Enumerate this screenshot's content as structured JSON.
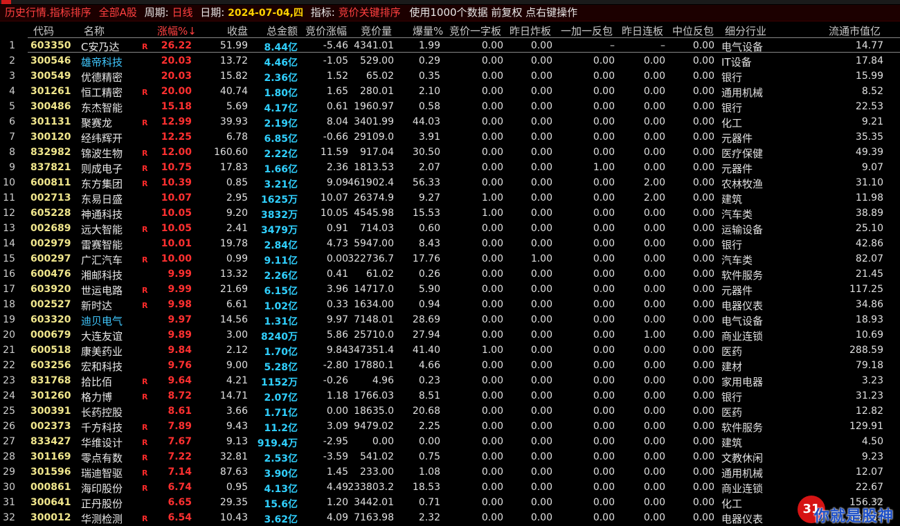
{
  "window": {
    "title_tag": "历史行情.指标排序",
    "market": "全部A股",
    "period_label": "周期:",
    "period_value": "日线",
    "date_label": "日期:",
    "date_value": "2024-07-04,四",
    "indicator_label": "指标:",
    "indicator_value": "竞价关键排序",
    "usage_note": "使用1000个数据 前复权 点右键操作"
  },
  "columns": [
    "代码",
    "名称",
    "涨幅%↓",
    "收盘",
    "总金额",
    "竞价涨幅",
    "竞价量",
    "爆量%",
    "竞价一字板",
    "昨日炸板",
    "一加一反包",
    "昨日连板",
    "中位反包",
    "细分行业",
    "流通市值亿"
  ],
  "rows": [
    {
      "n": "1",
      "code": "603350",
      "name": "C安乃达",
      "nc": "w",
      "r": true,
      "chg": "26.22",
      "close": "51.99",
      "amt": "8.44",
      "u": "亿",
      "jjzf": "-5.46",
      "jjl": "4341.01",
      "bl": "1.99",
      "yzb": "0.00",
      "zrzb": "0.00",
      "yjy": "–",
      "zrlb": "–",
      "zwfb": "0.00",
      "ind": "电气设备",
      "ltsz": "14.77"
    },
    {
      "n": "2",
      "code": "300546",
      "name": "雄帝科技",
      "nc": "c1",
      "r": false,
      "chg": "20.03",
      "close": "13.72",
      "amt": "4.46",
      "u": "亿",
      "jjzf": "-1.05",
      "jjl": "529.00",
      "bl": "0.29",
      "yzb": "0.00",
      "zrzb": "0.00",
      "yjy": "0.00",
      "zrlb": "0.00",
      "zwfb": "0.00",
      "ind": "IT设备",
      "ltsz": "17.84"
    },
    {
      "n": "3",
      "code": "300549",
      "name": "优德精密",
      "nc": "w",
      "r": false,
      "chg": "20.03",
      "close": "15.82",
      "amt": "2.36",
      "u": "亿",
      "jjzf": "1.52",
      "jjl": "65.02",
      "bl": "0.35",
      "yzb": "0.00",
      "zrzb": "0.00",
      "yjy": "0.00",
      "zrlb": "0.00",
      "zwfb": "0.00",
      "ind": "银行",
      "ltsz": "15.99"
    },
    {
      "n": "4",
      "code": "301261",
      "name": "恒工精密",
      "nc": "w",
      "r": true,
      "chg": "20.00",
      "close": "40.74",
      "amt": "1.80",
      "u": "亿",
      "jjzf": "1.65",
      "jjl": "280.01",
      "bl": "2.10",
      "yzb": "0.00",
      "zrzb": "0.00",
      "yjy": "0.00",
      "zrlb": "0.00",
      "zwfb": "0.00",
      "ind": "通用机械",
      "ltsz": "8.52"
    },
    {
      "n": "5",
      "code": "300486",
      "name": "东杰智能",
      "nc": "w",
      "r": false,
      "chg": "15.18",
      "close": "5.69",
      "amt": "4.17",
      "u": "亿",
      "jjzf": "0.61",
      "jjl": "1960.97",
      "bl": "0.58",
      "yzb": "0.00",
      "zrzb": "0.00",
      "yjy": "0.00",
      "zrlb": "0.00",
      "zwfb": "0.00",
      "ind": "银行",
      "ltsz": "22.53"
    },
    {
      "n": "6",
      "code": "301131",
      "name": "聚赛龙",
      "nc": "w",
      "r": true,
      "chg": "12.99",
      "close": "39.93",
      "amt": "2.19",
      "u": "亿",
      "jjzf": "8.04",
      "jjl": "3401.99",
      "bl": "44.03",
      "yzb": "0.00",
      "zrzb": "0.00",
      "yjy": "0.00",
      "zrlb": "0.00",
      "zwfb": "0.00",
      "ind": "化工",
      "ltsz": "9.21"
    },
    {
      "n": "7",
      "code": "300120",
      "name": "经纬辉开",
      "nc": "w",
      "r": false,
      "chg": "12.25",
      "close": "6.78",
      "amt": "6.85",
      "u": "亿",
      "jjzf": "-0.66",
      "jjl": "29109.0",
      "bl": "3.91",
      "yzb": "0.00",
      "zrzb": "0.00",
      "yjy": "0.00",
      "zrlb": "0.00",
      "zwfb": "0.00",
      "ind": "元器件",
      "ltsz": "35.35"
    },
    {
      "n": "8",
      "code": "832982",
      "name": "锦波生物",
      "nc": "w",
      "r": true,
      "chg": "12.00",
      "close": "160.60",
      "amt": "2.22",
      "u": "亿",
      "jjzf": "11.59",
      "jjl": "917.04",
      "bl": "30.50",
      "yzb": "0.00",
      "zrzb": "0.00",
      "yjy": "0.00",
      "zrlb": "0.00",
      "zwfb": "0.00",
      "ind": "医疗保健",
      "ltsz": "49.39"
    },
    {
      "n": "9",
      "code": "837821",
      "name": "则成电子",
      "nc": "w",
      "r": true,
      "chg": "10.75",
      "close": "17.83",
      "amt": "1.66",
      "u": "亿",
      "jjzf": "2.36",
      "jjl": "1813.53",
      "bl": "2.07",
      "yzb": "0.00",
      "zrzb": "0.00",
      "yjy": "1.00",
      "zrlb": "0.00",
      "zwfb": "0.00",
      "ind": "元器件",
      "ltsz": "9.07"
    },
    {
      "n": "10",
      "code": "600811",
      "name": "东方集团",
      "nc": "w",
      "r": true,
      "chg": "10.39",
      "close": "0.85",
      "amt": "3.21",
      "u": "亿",
      "jjzf": "9.09",
      "jjl": "461902.4",
      "bl": "56.33",
      "yzb": "0.00",
      "zrzb": "0.00",
      "yjy": "0.00",
      "zrlb": "2.00",
      "zwfb": "0.00",
      "ind": "农林牧渔",
      "ltsz": "31.10"
    },
    {
      "n": "11",
      "code": "002713",
      "name": "东易日盛",
      "nc": "w",
      "r": false,
      "chg": "10.07",
      "close": "2.95",
      "amt": "1625",
      "u": "万",
      "jjzf": "10.07",
      "jjl": "26374.9",
      "bl": "9.27",
      "yzb": "1.00",
      "zrzb": "0.00",
      "yjy": "0.00",
      "zrlb": "2.00",
      "zwfb": "0.00",
      "ind": "建筑",
      "ltsz": "11.98"
    },
    {
      "n": "12",
      "code": "605228",
      "name": "神通科技",
      "nc": "w",
      "r": false,
      "chg": "10.05",
      "close": "9.20",
      "amt": "3832",
      "u": "万",
      "jjzf": "10.05",
      "jjl": "4545.98",
      "bl": "15.53",
      "yzb": "1.00",
      "zrzb": "0.00",
      "yjy": "0.00",
      "zrlb": "0.00",
      "zwfb": "0.00",
      "ind": "汽车类",
      "ltsz": "38.89"
    },
    {
      "n": "13",
      "code": "002689",
      "name": "远大智能",
      "nc": "w",
      "r": true,
      "chg": "10.05",
      "close": "2.41",
      "amt": "3479",
      "u": "万",
      "jjzf": "0.91",
      "jjl": "714.03",
      "bl": "0.60",
      "yzb": "0.00",
      "zrzb": "0.00",
      "yjy": "0.00",
      "zrlb": "0.00",
      "zwfb": "0.00",
      "ind": "运输设备",
      "ltsz": "25.10"
    },
    {
      "n": "14",
      "code": "002979",
      "name": "雷赛智能",
      "nc": "w",
      "r": false,
      "chg": "10.01",
      "close": "19.78",
      "amt": "2.84",
      "u": "亿",
      "jjzf": "4.73",
      "jjl": "5947.00",
      "bl": "8.43",
      "yzb": "0.00",
      "zrzb": "0.00",
      "yjy": "0.00",
      "zrlb": "0.00",
      "zwfb": "0.00",
      "ind": "银行",
      "ltsz": "42.86"
    },
    {
      "n": "15",
      "code": "600297",
      "name": "广汇汽车",
      "nc": "w",
      "r": true,
      "chg": "10.00",
      "close": "0.99",
      "amt": "9.11",
      "u": "亿",
      "jjzf": "0.00",
      "jjl": "322736.7",
      "bl": "17.76",
      "yzb": "0.00",
      "zrzb": "1.00",
      "yjy": "0.00",
      "zrlb": "0.00",
      "zwfb": "0.00",
      "ind": "汽车类",
      "ltsz": "82.07"
    },
    {
      "n": "16",
      "code": "600476",
      "name": "湘邮科技",
      "nc": "w",
      "r": false,
      "chg": "9.99",
      "close": "13.32",
      "amt": "2.26",
      "u": "亿",
      "jjzf": "0.41",
      "jjl": "61.02",
      "bl": "0.26",
      "yzb": "0.00",
      "zrzb": "0.00",
      "yjy": "0.00",
      "zrlb": "0.00",
      "zwfb": "0.00",
      "ind": "软件服务",
      "ltsz": "21.45"
    },
    {
      "n": "17",
      "code": "603920",
      "name": "世运电路",
      "nc": "w",
      "r": true,
      "chg": "9.99",
      "close": "21.69",
      "amt": "6.15",
      "u": "亿",
      "jjzf": "3.96",
      "jjl": "14717.0",
      "bl": "5.90",
      "yzb": "0.00",
      "zrzb": "0.00",
      "yjy": "0.00",
      "zrlb": "0.00",
      "zwfb": "0.00",
      "ind": "元器件",
      "ltsz": "117.25"
    },
    {
      "n": "18",
      "code": "002527",
      "name": "新时达",
      "nc": "w",
      "r": true,
      "chg": "9.98",
      "close": "6.61",
      "amt": "1.02",
      "u": "亿",
      "jjzf": "0.33",
      "jjl": "1634.00",
      "bl": "0.94",
      "yzb": "0.00",
      "zrzb": "0.00",
      "yjy": "0.00",
      "zrlb": "0.00",
      "zwfb": "0.00",
      "ind": "电器仪表",
      "ltsz": "34.86"
    },
    {
      "n": "19",
      "code": "603320",
      "name": "迪贝电气",
      "nc": "c1",
      "r": false,
      "chg": "9.97",
      "close": "14.56",
      "amt": "1.31",
      "u": "亿",
      "jjzf": "9.97",
      "jjl": "7148.01",
      "bl": "28.69",
      "yzb": "0.00",
      "zrzb": "0.00",
      "yjy": "0.00",
      "zrlb": "0.00",
      "zwfb": "0.00",
      "ind": "电气设备",
      "ltsz": "18.93"
    },
    {
      "n": "20",
      "code": "000679",
      "name": "大连友谊",
      "nc": "w",
      "r": false,
      "chg": "9.89",
      "close": "3.00",
      "amt": "8240",
      "u": "万",
      "jjzf": "5.86",
      "jjl": "25710.0",
      "bl": "27.94",
      "yzb": "0.00",
      "zrzb": "0.00",
      "yjy": "0.00",
      "zrlb": "1.00",
      "zwfb": "0.00",
      "ind": "商业连锁",
      "ltsz": "10.69"
    },
    {
      "n": "21",
      "code": "600518",
      "name": "康美药业",
      "nc": "w",
      "r": false,
      "chg": "9.84",
      "close": "2.12",
      "amt": "1.70",
      "u": "亿",
      "jjzf": "9.84",
      "jjl": "347351.4",
      "bl": "41.40",
      "yzb": "1.00",
      "zrzb": "0.00",
      "yjy": "0.00",
      "zrlb": "0.00",
      "zwfb": "0.00",
      "ind": "医药",
      "ltsz": "288.59"
    },
    {
      "n": "22",
      "code": "603256",
      "name": "宏和科技",
      "nc": "w",
      "r": false,
      "chg": "9.76",
      "close": "9.00",
      "amt": "5.28",
      "u": "亿",
      "jjzf": "-2.80",
      "jjl": "17880.1",
      "bl": "4.66",
      "yzb": "0.00",
      "zrzb": "0.00",
      "yjy": "0.00",
      "zrlb": "0.00",
      "zwfb": "0.00",
      "ind": "建材",
      "ltsz": "79.18"
    },
    {
      "n": "23",
      "code": "831768",
      "name": "拾比佰",
      "nc": "w",
      "r": true,
      "chg": "9.64",
      "close": "4.21",
      "amt": "1152",
      "u": "万",
      "jjzf": "-0.26",
      "jjl": "4.96",
      "bl": "0.23",
      "yzb": "0.00",
      "zrzb": "0.00",
      "yjy": "0.00",
      "zrlb": "0.00",
      "zwfb": "0.00",
      "ind": "家用电器",
      "ltsz": "3.23"
    },
    {
      "n": "24",
      "code": "301260",
      "name": "格力博",
      "nc": "w",
      "r": true,
      "chg": "8.72",
      "close": "14.71",
      "amt": "2.07",
      "u": "亿",
      "jjzf": "1.18",
      "jjl": "1766.03",
      "bl": "8.51",
      "yzb": "0.00",
      "zrzb": "0.00",
      "yjy": "0.00",
      "zrlb": "0.00",
      "zwfb": "0.00",
      "ind": "银行",
      "ltsz": "31.23"
    },
    {
      "n": "25",
      "code": "300391",
      "name": "长药控股",
      "nc": "w",
      "r": false,
      "chg": "8.61",
      "close": "3.66",
      "amt": "1.71",
      "u": "亿",
      "jjzf": "0.00",
      "jjl": "18635.0",
      "bl": "20.68",
      "yzb": "0.00",
      "zrzb": "0.00",
      "yjy": "0.00",
      "zrlb": "0.00",
      "zwfb": "0.00",
      "ind": "医药",
      "ltsz": "12.82"
    },
    {
      "n": "26",
      "code": "002373",
      "name": "千方科技",
      "nc": "w",
      "r": true,
      "chg": "7.89",
      "close": "9.43",
      "amt": "11.2",
      "u": "亿",
      "jjzf": "3.09",
      "jjl": "9479.02",
      "bl": "2.25",
      "yzb": "0.00",
      "zrzb": "0.00",
      "yjy": "0.00",
      "zrlb": "0.00",
      "zwfb": "0.00",
      "ind": "软件服务",
      "ltsz": "129.91"
    },
    {
      "n": "27",
      "code": "833427",
      "name": "华维设计",
      "nc": "w",
      "r": true,
      "chg": "7.67",
      "close": "9.13",
      "amt": "919.4",
      "u": "万",
      "jjzf": "-2.95",
      "jjl": "0.00",
      "bl": "0.00",
      "yzb": "0.00",
      "zrzb": "0.00",
      "yjy": "0.00",
      "zrlb": "0.00",
      "zwfb": "0.00",
      "ind": "建筑",
      "ltsz": "4.50"
    },
    {
      "n": "28",
      "code": "301169",
      "name": "零点有数",
      "nc": "w",
      "r": true,
      "chg": "7.22",
      "close": "32.81",
      "amt": "2.53",
      "u": "亿",
      "jjzf": "-3.59",
      "jjl": "541.02",
      "bl": "0.75",
      "yzb": "0.00",
      "zrzb": "0.00",
      "yjy": "0.00",
      "zrlb": "0.00",
      "zwfb": "0.00",
      "ind": "文教休闲",
      "ltsz": "9.23"
    },
    {
      "n": "29",
      "code": "301596",
      "name": "瑞迪智驱",
      "nc": "w",
      "r": true,
      "chg": "7.14",
      "close": "87.63",
      "amt": "3.90",
      "u": "亿",
      "jjzf": "1.45",
      "jjl": "233.00",
      "bl": "1.08",
      "yzb": "0.00",
      "zrzb": "0.00",
      "yjy": "0.00",
      "zrlb": "0.00",
      "zwfb": "0.00",
      "ind": "通用机械",
      "ltsz": "12.07"
    },
    {
      "n": "30",
      "code": "000861",
      "name": "海印股份",
      "nc": "w",
      "r": true,
      "chg": "6.74",
      "close": "0.95",
      "amt": "4.13",
      "u": "亿",
      "jjzf": "4.49",
      "jjl": "233803.2",
      "bl": "18.53",
      "yzb": "0.00",
      "zrzb": "0.00",
      "yjy": "0.00",
      "zrlb": "0.00",
      "zwfb": "0.00",
      "ind": "商业连锁",
      "ltsz": "22.67"
    },
    {
      "n": "31",
      "code": "300641",
      "name": "正丹股份",
      "nc": "w",
      "r": false,
      "chg": "6.65",
      "close": "29.35",
      "amt": "15.6",
      "u": "亿",
      "jjzf": "1.20",
      "jjl": "3442.01",
      "bl": "0.71",
      "yzb": "0.00",
      "zrzb": "0.00",
      "yjy": "0.00",
      "zrlb": "0.00",
      "zwfb": "0.00",
      "ind": "化工",
      "ltsz": "156.32"
    },
    {
      "n": "32",
      "code": "300012",
      "name": "华测检测",
      "nc": "w",
      "r": true,
      "chg": "6.54",
      "close": "10.43",
      "amt": "3.62",
      "u": "亿",
      "jjzf": "4.09",
      "jjl": "7163.98",
      "bl": "2.32",
      "yzb": "0.00",
      "zrzb": "0.00",
      "yjy": "0.00",
      "zrlb": "0.00",
      "zwfb": "0.00",
      "ind": "电器仪表",
      "ltsz": "143.33"
    }
  ],
  "r_mark": "R",
  "watermark": {
    "badge": "31",
    "text": "你就是股神",
    "url": ".cn"
  },
  "colors": {
    "up": "#ff3030",
    "amount": "#30d0ff",
    "code": "#f0e68c",
    "background": "#000000"
  }
}
